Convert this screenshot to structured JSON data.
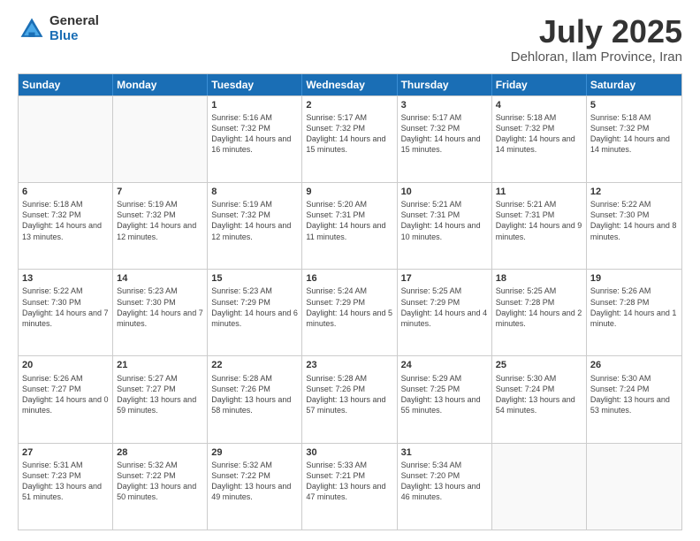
{
  "header": {
    "logo_general": "General",
    "logo_blue": "Blue",
    "month_title": "July 2025",
    "location": "Dehloran, Ilam Province, Iran"
  },
  "calendar": {
    "days_of_week": [
      "Sunday",
      "Monday",
      "Tuesday",
      "Wednesday",
      "Thursday",
      "Friday",
      "Saturday"
    ],
    "weeks": [
      [
        {
          "day": "",
          "info": ""
        },
        {
          "day": "",
          "info": ""
        },
        {
          "day": "1",
          "info": "Sunrise: 5:16 AM\nSunset: 7:32 PM\nDaylight: 14 hours and 16 minutes."
        },
        {
          "day": "2",
          "info": "Sunrise: 5:17 AM\nSunset: 7:32 PM\nDaylight: 14 hours and 15 minutes."
        },
        {
          "day": "3",
          "info": "Sunrise: 5:17 AM\nSunset: 7:32 PM\nDaylight: 14 hours and 15 minutes."
        },
        {
          "day": "4",
          "info": "Sunrise: 5:18 AM\nSunset: 7:32 PM\nDaylight: 14 hours and 14 minutes."
        },
        {
          "day": "5",
          "info": "Sunrise: 5:18 AM\nSunset: 7:32 PM\nDaylight: 14 hours and 14 minutes."
        }
      ],
      [
        {
          "day": "6",
          "info": "Sunrise: 5:18 AM\nSunset: 7:32 PM\nDaylight: 14 hours and 13 minutes."
        },
        {
          "day": "7",
          "info": "Sunrise: 5:19 AM\nSunset: 7:32 PM\nDaylight: 14 hours and 12 minutes."
        },
        {
          "day": "8",
          "info": "Sunrise: 5:19 AM\nSunset: 7:32 PM\nDaylight: 14 hours and 12 minutes."
        },
        {
          "day": "9",
          "info": "Sunrise: 5:20 AM\nSunset: 7:31 PM\nDaylight: 14 hours and 11 minutes."
        },
        {
          "day": "10",
          "info": "Sunrise: 5:21 AM\nSunset: 7:31 PM\nDaylight: 14 hours and 10 minutes."
        },
        {
          "day": "11",
          "info": "Sunrise: 5:21 AM\nSunset: 7:31 PM\nDaylight: 14 hours and 9 minutes."
        },
        {
          "day": "12",
          "info": "Sunrise: 5:22 AM\nSunset: 7:30 PM\nDaylight: 14 hours and 8 minutes."
        }
      ],
      [
        {
          "day": "13",
          "info": "Sunrise: 5:22 AM\nSunset: 7:30 PM\nDaylight: 14 hours and 7 minutes."
        },
        {
          "day": "14",
          "info": "Sunrise: 5:23 AM\nSunset: 7:30 PM\nDaylight: 14 hours and 7 minutes."
        },
        {
          "day": "15",
          "info": "Sunrise: 5:23 AM\nSunset: 7:29 PM\nDaylight: 14 hours and 6 minutes."
        },
        {
          "day": "16",
          "info": "Sunrise: 5:24 AM\nSunset: 7:29 PM\nDaylight: 14 hours and 5 minutes."
        },
        {
          "day": "17",
          "info": "Sunrise: 5:25 AM\nSunset: 7:29 PM\nDaylight: 14 hours and 4 minutes."
        },
        {
          "day": "18",
          "info": "Sunrise: 5:25 AM\nSunset: 7:28 PM\nDaylight: 14 hours and 2 minutes."
        },
        {
          "day": "19",
          "info": "Sunrise: 5:26 AM\nSunset: 7:28 PM\nDaylight: 14 hours and 1 minute."
        }
      ],
      [
        {
          "day": "20",
          "info": "Sunrise: 5:26 AM\nSunset: 7:27 PM\nDaylight: 14 hours and 0 minutes."
        },
        {
          "day": "21",
          "info": "Sunrise: 5:27 AM\nSunset: 7:27 PM\nDaylight: 13 hours and 59 minutes."
        },
        {
          "day": "22",
          "info": "Sunrise: 5:28 AM\nSunset: 7:26 PM\nDaylight: 13 hours and 58 minutes."
        },
        {
          "day": "23",
          "info": "Sunrise: 5:28 AM\nSunset: 7:26 PM\nDaylight: 13 hours and 57 minutes."
        },
        {
          "day": "24",
          "info": "Sunrise: 5:29 AM\nSunset: 7:25 PM\nDaylight: 13 hours and 55 minutes."
        },
        {
          "day": "25",
          "info": "Sunrise: 5:30 AM\nSunset: 7:24 PM\nDaylight: 13 hours and 54 minutes."
        },
        {
          "day": "26",
          "info": "Sunrise: 5:30 AM\nSunset: 7:24 PM\nDaylight: 13 hours and 53 minutes."
        }
      ],
      [
        {
          "day": "27",
          "info": "Sunrise: 5:31 AM\nSunset: 7:23 PM\nDaylight: 13 hours and 51 minutes."
        },
        {
          "day": "28",
          "info": "Sunrise: 5:32 AM\nSunset: 7:22 PM\nDaylight: 13 hours and 50 minutes."
        },
        {
          "day": "29",
          "info": "Sunrise: 5:32 AM\nSunset: 7:22 PM\nDaylight: 13 hours and 49 minutes."
        },
        {
          "day": "30",
          "info": "Sunrise: 5:33 AM\nSunset: 7:21 PM\nDaylight: 13 hours and 47 minutes."
        },
        {
          "day": "31",
          "info": "Sunrise: 5:34 AM\nSunset: 7:20 PM\nDaylight: 13 hours and 46 minutes."
        },
        {
          "day": "",
          "info": ""
        },
        {
          "day": "",
          "info": ""
        }
      ]
    ]
  }
}
